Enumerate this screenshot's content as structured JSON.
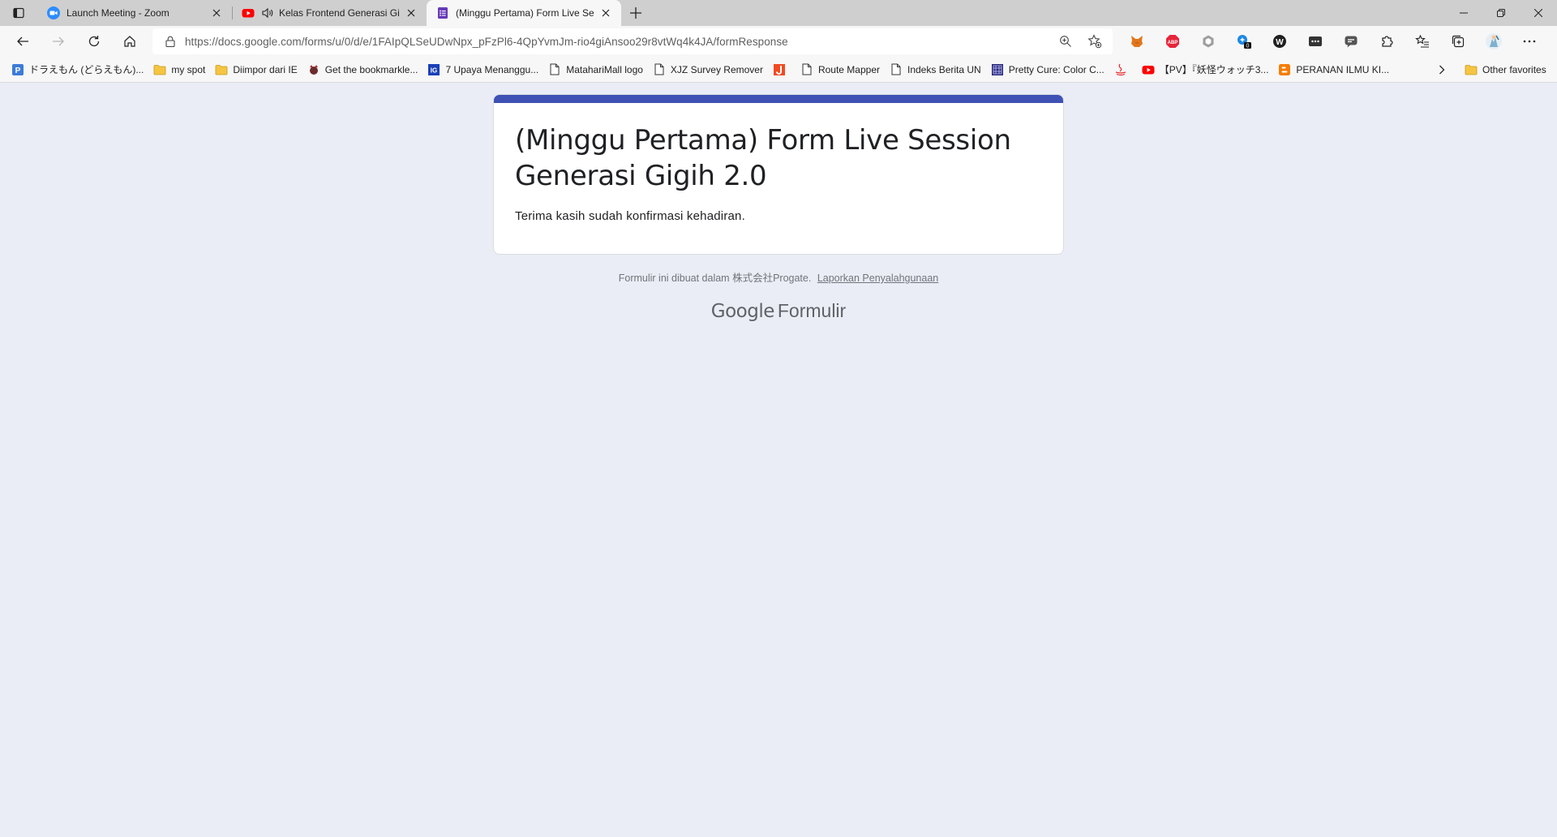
{
  "browser": {
    "tabs": [
      {
        "title": "Launch Meeting - Zoom",
        "favicon": "zoom-icon",
        "color": "#2D8CFF"
      },
      {
        "title": "Kelas Frontend Generasi Gigih",
        "favicon": "youtube-icon",
        "color": "#FF0000",
        "audio": true
      },
      {
        "title": "(Minggu Pertama) Form Live Session",
        "favicon": "google-forms-icon",
        "color": "#673AB7",
        "active": true
      }
    ],
    "url": "https://docs.google.com/forms/u/0/d/e/1FAIpQLSeUDwNpx_pFzPl6-4QpYvmJm-rio4giAnsoo29r8vtWq4k4JA/formResponse",
    "bookmarks": [
      {
        "label": "ドラえもん (どらえもん)...",
        "icon": "p-icon"
      },
      {
        "label": "my spot",
        "icon": "folder-icon"
      },
      {
        "label": "Diimpor dari IE",
        "icon": "folder-icon"
      },
      {
        "label": "Get the bookmarkle...",
        "icon": "bookmarklet-icon"
      },
      {
        "label": "7 Upaya Menanggu...",
        "icon": "ig-icon"
      },
      {
        "label": "MatahariMall logo",
        "icon": "page-icon"
      },
      {
        "label": "XJZ Survey Remover",
        "icon": "page-icon"
      },
      {
        "label": "",
        "icon": "j-icon"
      },
      {
        "label": "Route Mapper",
        "icon": "page-icon"
      },
      {
        "label": "Indeks Berita UN",
        "icon": "page-icon"
      },
      {
        "label": "Pretty Cure: Color C...",
        "icon": "grid-icon"
      },
      {
        "label": "",
        "icon": "java-icon"
      },
      {
        "label": "【PV】『妖怪ウォッチ3...",
        "icon": "youtube-icon"
      },
      {
        "label": "PERANAN ILMU KI...",
        "icon": "blogger-icon"
      }
    ],
    "other_favorites": "Other favorites"
  },
  "form": {
    "title": "(Minggu Pertama) Form Live Session Generasi Gigih 2.0",
    "message": "Terima kasih sudah konfirmasi kehadiran.",
    "accent_color": "#3F51B5",
    "footer_prefix": "Formulir ini dibuat dalam 株式会社Progate.",
    "report_link": "Laporkan Penyalahgunaan",
    "brand_google": "Google",
    "brand_product": "Formulir"
  }
}
